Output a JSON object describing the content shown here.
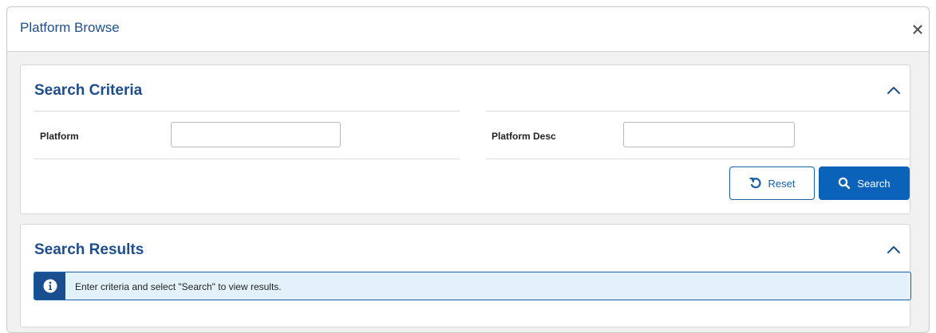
{
  "modal": {
    "title": "Platform Browse",
    "close_icon": "close-icon"
  },
  "search_criteria": {
    "title": "Search Criteria",
    "collapse_icon": "chevron-up-icon",
    "fields": {
      "platform": {
        "label": "Platform",
        "value": "",
        "placeholder": ""
      },
      "platform_desc": {
        "label": "Platform Desc",
        "value": "",
        "placeholder": ""
      }
    },
    "reset_label": "Reset",
    "reset_icon": "undo-icon",
    "search_label": "Search",
    "search_icon": "search-icon"
  },
  "search_results": {
    "title": "Search Results",
    "collapse_icon": "chevron-up-icon",
    "info_icon": "info-icon",
    "message": "Enter criteria and select \"Search\" to view results."
  },
  "colors": {
    "brand_blue": "#1f4e8c",
    "primary_button": "#0a63b8",
    "info_background": "#e3f2fa",
    "info_icon_background": "#1a4f8f"
  }
}
